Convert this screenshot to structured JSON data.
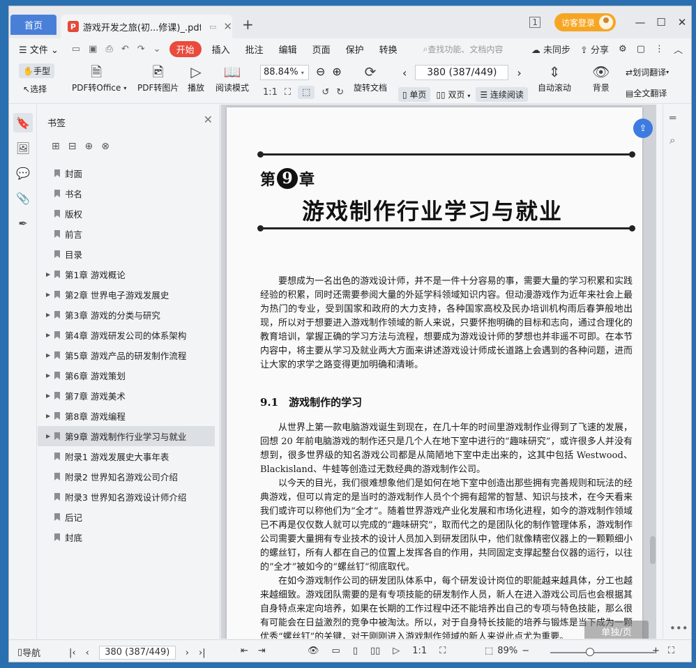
{
  "tabs": {
    "home": "首页",
    "doc_badge": "P",
    "doc_title": "游戏开发之旅(初...修课)_.pdf"
  },
  "window": {
    "layout_icon": "1",
    "login_label": "访客登录"
  },
  "menu": {
    "file": "文件",
    "items": [
      "开始",
      "插入",
      "批注",
      "编辑",
      "页面",
      "保护",
      "转换"
    ],
    "search_placeholder": "查找功能、文档内容",
    "sync": "未同步",
    "share": "分享"
  },
  "toolbar": {
    "hand": "手型",
    "select": "选择",
    "pdf_to_office": "PDF转Office",
    "pdf_to_image": "PDF转图片",
    "play": "播放",
    "read_mode": "阅读模式",
    "zoom": "88.84%",
    "rotate_doc": "旋转文档",
    "page_indicator": "380 (387/449)",
    "single_page": "单页",
    "double_page": "双页",
    "continuous": "连续阅读",
    "auto_scroll": "自动滚动",
    "background": "背景",
    "word_translate": "划词翻译",
    "full_translate": "全文翻译"
  },
  "bookmarks": {
    "title": "书签",
    "items": [
      {
        "label": "封面",
        "expandable": false
      },
      {
        "label": "书名",
        "expandable": false
      },
      {
        "label": "版权",
        "expandable": false
      },
      {
        "label": "前言",
        "expandable": false
      },
      {
        "label": "目录",
        "expandable": false
      },
      {
        "label": "第1章 游戏概论",
        "expandable": true
      },
      {
        "label": "第2章 世界电子游戏发展史",
        "expandable": true
      },
      {
        "label": "第3章 游戏的分类与研究",
        "expandable": true
      },
      {
        "label": "第4章 游戏研发公司的体系架构",
        "expandable": true
      },
      {
        "label": "第5章 游戏产品的研发制作流程",
        "expandable": true
      },
      {
        "label": "第6章 游戏策划",
        "expandable": true
      },
      {
        "label": "第7章 游戏美术",
        "expandable": true
      },
      {
        "label": "第8章 游戏编程",
        "expandable": true
      },
      {
        "label": "第9章 游戏制作行业学习与就业",
        "expandable": true,
        "selected": true
      },
      {
        "label": "附录1 游戏发展史大事年表",
        "expandable": false
      },
      {
        "label": "附录2 世界知名游戏公司介绍",
        "expandable": false
      },
      {
        "label": "附录3 世界知名游戏设计师介绍",
        "expandable": false
      },
      {
        "label": "后记",
        "expandable": false
      },
      {
        "label": "封底",
        "expandable": false
      }
    ]
  },
  "document": {
    "chapter_prefix": "第",
    "chapter_num": "9",
    "chapter_suffix": "章",
    "chapter_title": "游戏制作行业学习与就业",
    "intro": "要想成为一名出色的游戏设计师，并不是一件十分容易的事，需要大量的学习积累和实践经验的积累，同时还需要参阅大量的外延学科领域知识内容。但动漫游戏作为近年来社会上最为热门的专业，受到国家和政府的大力支持，各种国家高校及民办培训机构雨后春笋般地出现，所以对于想要进入游戏制作领域的新人来说，只要怀抱明确的目标和志向，通过合理化的教育培训，掌握正确的学习方法与流程，想要成为游戏设计师的梦想也并非遥不可即。在本节内容中，将主要从学习及就业两大方面来讲述游戏设计师成长道路上会遇到的各种问题，进而让大家的求学之路变得更加明确和清晰。",
    "section_title": "9.1　游戏制作的学习",
    "p1": "从世界上第一款电脑游戏诞生到现在，在几十年的时间里游戏制作业得到了飞速的发展，回想 20 年前电脑游戏的制作还只是几个人在地下室中进行的“趣味研究”，或许很多人并没有想到，很多世界级的知名游戏公司都是从简陋地下室中走出来的，这其中包括 Westwood、Blackisland、牛蛙等创造过无数经典的游戏制作公司。",
    "p2": "以今天的目光，我们很难想象他们是如何在地下室中创造出那些拥有完善规则和玩法的经典游戏，但可以肯定的是当时的游戏制作人员个个拥有超常的智慧、知识与技术，在今天看来我们或许可以称他们为“全才”。随着世界游戏产业化发展和市场化进程，如今的游戏制作领域已不再是仅仅数人就可以完成的“趣味研究”，取而代之的是团队化的制作管理体系，游戏制作公司需要大量拥有专业技术的设计人员加入到研发团队中，他们就像精密仪器上的一颗颗细小的螺丝钉，所有人都在自己的位置上发挥各自的作用，共同固定支撑起整台仪器的运行，以往的“全才”被如今的“螺丝钉”彻底取代。",
    "p3": "在如今游戏制作公司的研发团队体系中，每个研发设计岗位的职能越来越具体，分工也越来越细致。游戏团队需要的是有专项技能的研发制作人员，新人在进入游戏公司后也会根据其自身特点来定向培养，如果在长期的工作过程中还不能培养出自己的专项与特色技能，那么很有可能会在日益激烈的竞争中被淘汰。所以，对于自身特长技能的培养与锻炼是当下成为一颗优秀“螺丝钉”的关键，对于刚刚进入游戏制作领域的新人来说此点尤为重要。",
    "page_tip": "单独/页"
  },
  "statusbar": {
    "nav": "导航",
    "page_indicator": "380 (387/449)",
    "zoom": "89%",
    "zoom_level": 0.38
  }
}
